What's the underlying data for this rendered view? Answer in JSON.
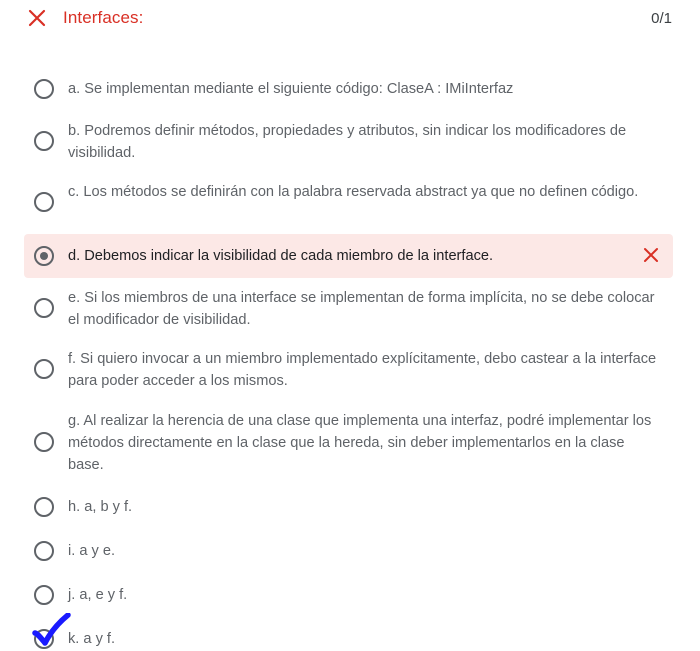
{
  "question": {
    "title": "Interfaces:",
    "score": "0/1",
    "status_color": "#d93025"
  },
  "options": [
    {
      "label": "a. Se implementan mediante el siguiente código: ClaseA : IMiInterfaz"
    },
    {
      "label": "b. Podremos definir métodos, propiedades y atributos, sin indicar los modificadores de visibilidad."
    },
    {
      "label": "c. Los métodos se definirán con la palabra reservada abstract ya que no definen código."
    },
    {
      "label": "d. Debemos indicar la visibilidad de cada miembro de la interface.",
      "selected": true,
      "incorrect": true
    },
    {
      "label": "e. Si los miembros de una interface se implementan de forma implícita, no se debe colocar el modificador de visibilidad."
    },
    {
      "label": "f. Si quiero invocar a un miembro implementado explícitamente, debo castear a la interface para poder acceder a los mismos."
    },
    {
      "label": "g. Al realizar la herencia de una clase que implementa una interfaz, podré implementar los métodos directamente en la clase que la hereda, sin deber implementarlos en la clase base."
    },
    {
      "label": "h. a, b y f."
    },
    {
      "label": "i. a y e."
    },
    {
      "label": "j. a, e y f."
    },
    {
      "label": "k. a y f.",
      "annotated_correct": true
    }
  ],
  "icons": {
    "header": "close-x-icon",
    "wrong_mark": "close-x-icon",
    "handwritten_mark": "checkmark-icon"
  },
  "colors": {
    "error": "#d93025",
    "selected_background": "#fce8e6",
    "handwritten_check": "#1a1aff"
  }
}
